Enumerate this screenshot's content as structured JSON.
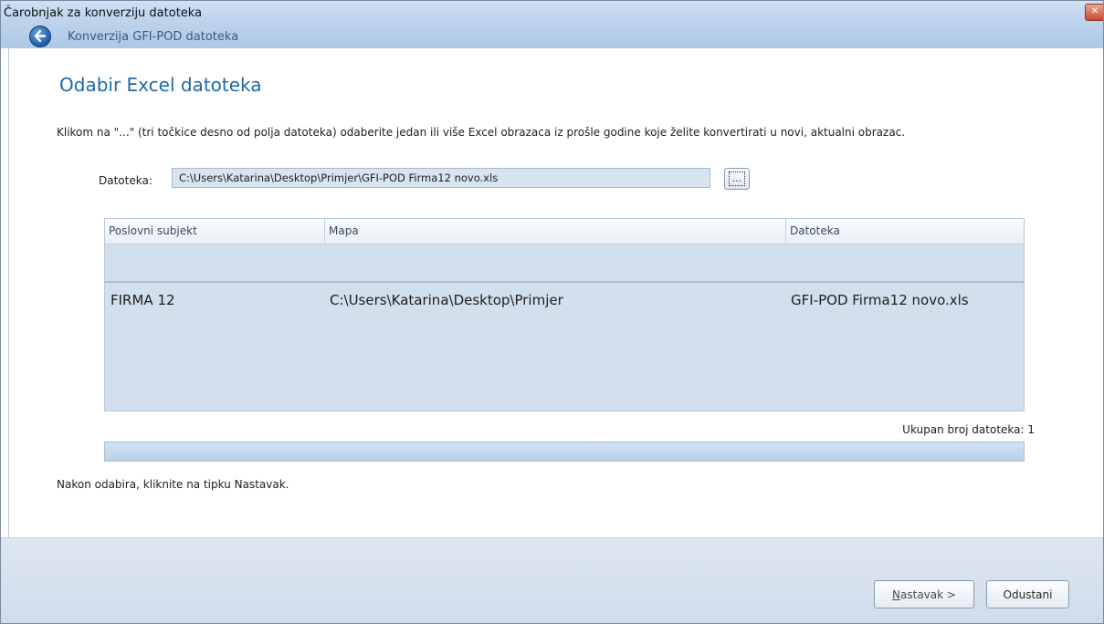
{
  "window": {
    "title": "Čarobnjak za konverziju datoteka",
    "close_symbol": "✕"
  },
  "nav": {
    "title": "Konverzija GFI-POD datoteka",
    "back_icon": "back-arrow-icon"
  },
  "page": {
    "heading": "Odabir Excel datoteka",
    "instruction": "Klikom na \"...\" (tri točkice desno od polja datoteka) odaberite jedan ili više Excel obrazaca iz prošle godine koje želite konvertirati u novi, aktualni obrazac.",
    "file_label": "Datoteka:",
    "file_value": "C:\\Users\\Katarina\\Desktop\\Primjer\\GFI-POD Firma12 novo.xls",
    "browse_label": "..."
  },
  "table": {
    "columns": [
      "Poslovni subjekt",
      "Mapa",
      "Datoteka"
    ],
    "rows": [
      {
        "subject": "FIRMA 12",
        "folder": "C:\\Users\\Katarina\\Desktop\\Primjer",
        "file": "GFI-POD Firma12 novo.xls"
      }
    ]
  },
  "total_label": "Ukupan broj datoteka: 1",
  "progress": {
    "value": 1.0
  },
  "footer_note": "Nakon odabira, kliknite na tipku Nastavak.",
  "buttons": {
    "next_mnemonic": "N",
    "next_rest": "astavak >",
    "cancel": "Odustani"
  },
  "colors": {
    "accent": "#1e6aa8",
    "chrome": "#bcd3ec",
    "grid": "#d2dfec"
  }
}
